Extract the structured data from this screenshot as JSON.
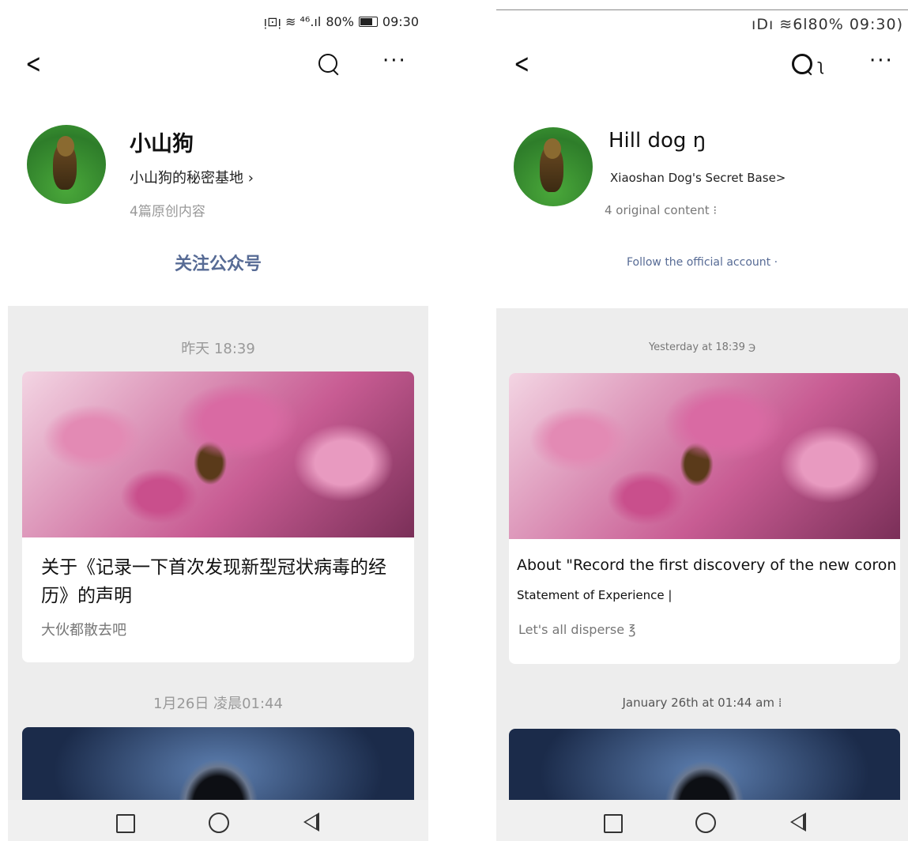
{
  "left": {
    "status": {
      "icons": "ᴉ⊡ᴉ ≋ ⁴⁶.ıl",
      "battery": "80%",
      "time": "09:30"
    },
    "nav": {
      "back_icon": "back-chevron-icon",
      "more": "···"
    },
    "profile": {
      "name": "小山狗",
      "subtitle": "小山狗的秘密基地 ›",
      "count": "4篇原创内容",
      "follow": "关注公众号"
    },
    "feed": [
      {
        "date": "昨天 18:39",
        "title": "关于《记录一下首次发现新型冠状病毒的经历》的声明",
        "digest": "大伙都散去吧"
      },
      {
        "date": "1月26日 凌晨01:44"
      }
    ]
  },
  "right": {
    "status": {
      "text": "ıDı ≋6l80% 09:30)"
    },
    "nav": {
      "back_icon": "back-chevron-icon",
      "more": "···",
      "search_suffix": "ʅ"
    },
    "profile": {
      "name": "Hill dog ŋ",
      "subtitle": "Xiaoshan Dog's Secret Base>",
      "count": "4 original content ⁝",
      "follow": "Follow the official account ·"
    },
    "feed": [
      {
        "date": "Yesterday at 18:39 ℈",
        "title_line1": "About \"Record the first discovery of the new coronavirus ȷ",
        "title_line2": "Statement of Experience |",
        "digest": "Let's all disperse ℥"
      },
      {
        "date": "January 26th at 01:44 am ⁞"
      }
    ]
  },
  "colors": {
    "follow": "#576b95",
    "feed_bg": "#ededed",
    "muted": "#999999"
  }
}
